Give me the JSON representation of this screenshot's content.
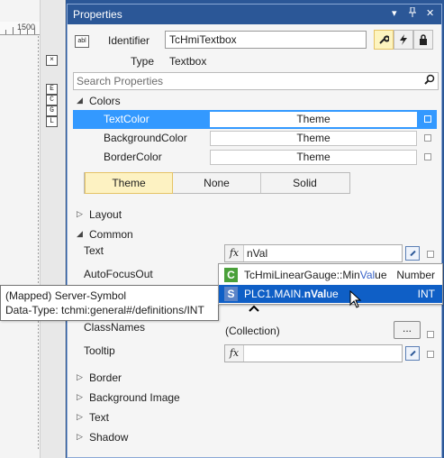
{
  "left": {
    "ruler_number": "1500",
    "side_buttons": [
      "×",
      "E",
      "C",
      "G",
      "L"
    ]
  },
  "panel": {
    "title": "Properties",
    "title_controls": [
      "▾",
      "⊞",
      "✕"
    ],
    "identifier_label": "Identifier",
    "identifier_value": "TcHmiTextbox",
    "type_label": "Type",
    "type_value": "Textbox",
    "search_placeholder": "Search Properties"
  },
  "sections": {
    "colors": "Colors",
    "layout": "Layout",
    "common": "Common",
    "border": "Border",
    "background_image": "Background Image",
    "text": "Text",
    "shadow": "Shadow"
  },
  "colors": {
    "rows": [
      {
        "name": "TextColor",
        "value": "Theme"
      },
      {
        "name": "BackgroundColor",
        "value": "Theme"
      },
      {
        "name": "BorderColor",
        "value": "Theme"
      }
    ],
    "segments": [
      "Theme",
      "None",
      "Solid"
    ]
  },
  "common": {
    "text_label": "Text",
    "text_value": "nVal",
    "autofocus_label": "AutoFocusOut",
    "classnames_label": "ClassNames",
    "classnames_value": "(Collection)",
    "collection_button": "...",
    "tooltip_label": "Tooltip",
    "fx": "fx"
  },
  "autocomplete": {
    "items": [
      {
        "icon": "C",
        "prefix": "TcHmiLinearGauge::Min",
        "match": "Val",
        "suffix": "ue",
        "type": "Number"
      },
      {
        "icon": "S",
        "prefix": "PLC1.MAIN.",
        "match": "nVal",
        "suffix": "ue",
        "type": "INT"
      }
    ]
  },
  "tooltip": {
    "line1": "(Mapped) Server-Symbol",
    "line2": "Data-Type: tchmi:general#/definitions/INT"
  },
  "colors_hex": {
    "accent": "#2b5797",
    "selection": "#3399ff",
    "autocomplete_highlight": "#0f5fc6",
    "class_icon": "#4aa03a",
    "symbol_icon": "#5b84c8"
  }
}
